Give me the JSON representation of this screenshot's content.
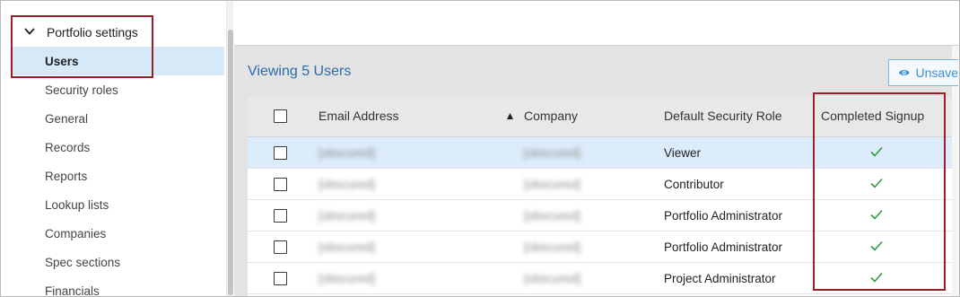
{
  "sidebar": {
    "section_label": "Portfolio settings",
    "section_icon": "chevron-down-icon",
    "items": [
      {
        "label": "Users",
        "active": true
      },
      {
        "label": "Security roles"
      },
      {
        "label": "General"
      },
      {
        "label": "Records"
      },
      {
        "label": "Reports"
      },
      {
        "label": "Lookup lists"
      },
      {
        "label": "Companies"
      },
      {
        "label": "Spec sections"
      },
      {
        "label": "Financials"
      }
    ]
  },
  "main": {
    "viewing_label": "Viewing 5 Users",
    "unsaved_button": {
      "label": "Unsave",
      "icon": "eye-icon"
    }
  },
  "table": {
    "columns": [
      "Email Address",
      "Company",
      "Default Security Role",
      "Completed Signup"
    ],
    "sort_icon": "sort-ascending-icon",
    "rows": [
      {
        "email": "[obscured]",
        "company": "[obscured]",
        "role": "Viewer",
        "signup_icon": "checkmark-icon"
      },
      {
        "email": "[obscured]",
        "company": "[obscured]",
        "role": "Contributor",
        "signup_icon": "checkmark-icon"
      },
      {
        "email": "[obscured]",
        "company": "[obscured]",
        "role": "Portfolio Administrator",
        "signup_icon": "checkmark-icon"
      },
      {
        "email": "[obscured]",
        "company": "[obscured]",
        "role": "Portfolio Administrator",
        "signup_icon": "checkmark-icon"
      },
      {
        "email": "[obscured]",
        "company": "[obscured]",
        "role": "Project Administrator",
        "signup_icon": "checkmark-icon"
      }
    ]
  },
  "colors": {
    "accent_blue": "#2a6bb0",
    "highlight_row": "#dcecfa",
    "active_sidebar": "#d5e9f8",
    "callout_red": "#9e1d2b",
    "check_green": "#2e9b3e"
  }
}
